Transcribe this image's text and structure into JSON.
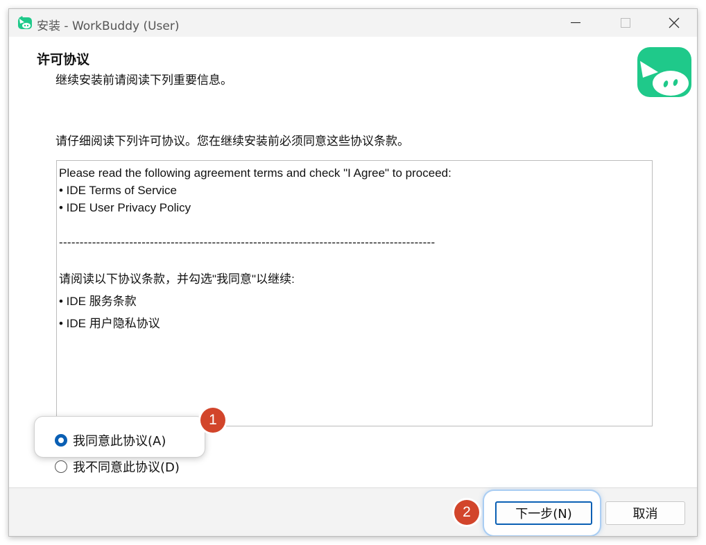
{
  "window": {
    "title": "安装 - WorkBuddy (User)",
    "controls": {
      "minimize": "—",
      "maximize": "☐",
      "close": "✕"
    }
  },
  "header": {
    "title": "许可协议",
    "subtitle": "继续安装前请阅读下列重要信息。"
  },
  "instruction": "请仔细阅读下列许可协议。您在继续安装前必须同意这些协议条款。",
  "license": {
    "lines_en": [
      "Please read the following agreement terms and check \"I Agree\" to proceed:",
      "• IDE Terms of Service",
      "• IDE User Privacy Policy"
    ],
    "separator": "-------------------------------------------------------------------------------------------",
    "lines_cn": [
      "请阅读以下协议条款，并勾选\"我同意\"以继续:",
      "• IDE 服务条款",
      "• IDE 用户隐私协议"
    ]
  },
  "options": {
    "agree": {
      "label": "我同意此协议(A)",
      "checked": true
    },
    "disagree": {
      "label": "我不同意此协议(D)",
      "checked": false
    }
  },
  "buttons": {
    "next": "下一步(N)",
    "cancel": "取消"
  },
  "annotations": {
    "step1": "1",
    "step2": "2"
  },
  "colors": {
    "accent": "#0a5fb4",
    "badge": "#d2452b",
    "brand_green": "#1fc98a"
  },
  "icons": {
    "title_logo": "workbuddy-logo-icon",
    "app_icon": "workbuddy-app-icon"
  }
}
